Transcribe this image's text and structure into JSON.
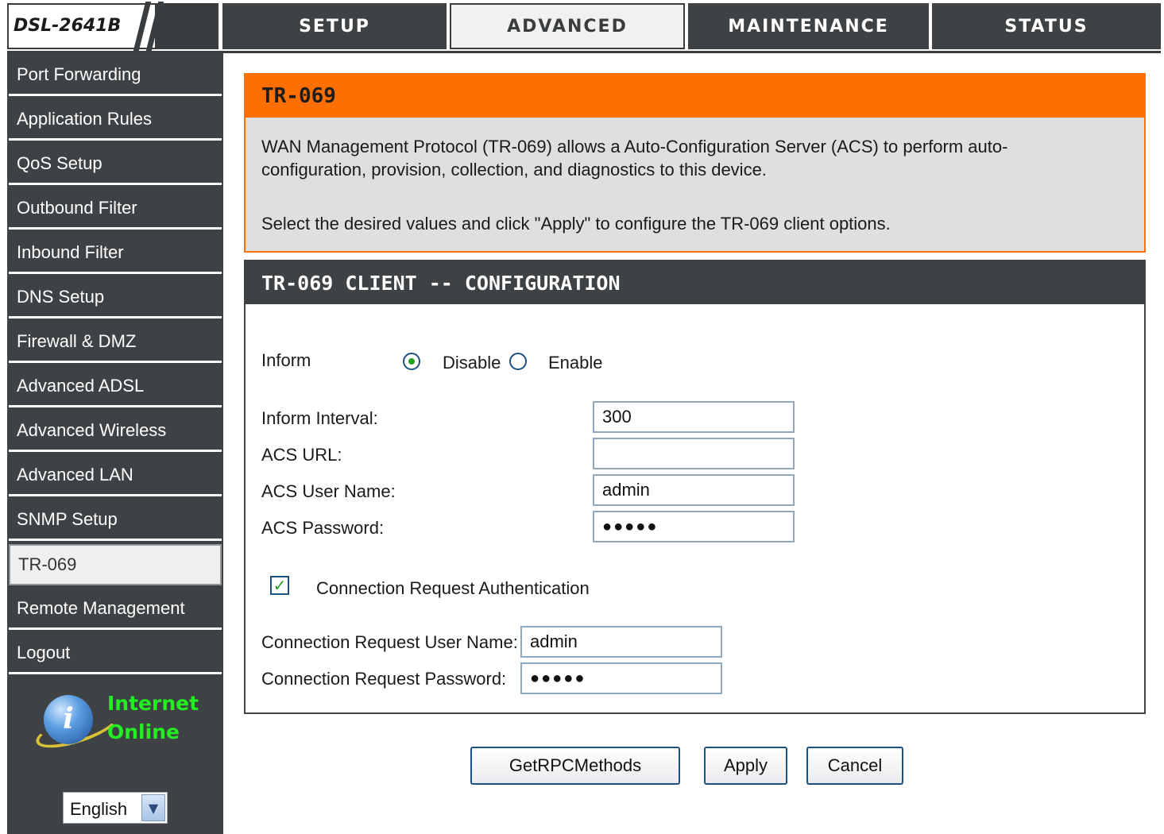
{
  "brand": {
    "model": "DSL-2641B"
  },
  "topnav": {
    "tabs": [
      {
        "label": "SETUP"
      },
      {
        "label": "ADVANCED"
      },
      {
        "label": "MAINTENANCE"
      },
      {
        "label": "STATUS"
      }
    ],
    "active": "ADVANCED"
  },
  "sidebar": {
    "items": [
      {
        "label": "Port Forwarding"
      },
      {
        "label": "Application Rules"
      },
      {
        "label": "QoS Setup"
      },
      {
        "label": "Outbound Filter"
      },
      {
        "label": "Inbound Filter"
      },
      {
        "label": "DNS Setup"
      },
      {
        "label": "Firewall & DMZ"
      },
      {
        "label": "Advanced ADSL"
      },
      {
        "label": "Advanced Wireless"
      },
      {
        "label": "Advanced LAN"
      },
      {
        "label": "SNMP Setup"
      },
      {
        "label": "TR-069"
      },
      {
        "label": "Remote Management"
      },
      {
        "label": "Logout"
      }
    ],
    "active": "TR-069",
    "status": {
      "line1": "Internet",
      "line2": "Online",
      "color": "#22ee22"
    },
    "language": {
      "selected": "English"
    }
  },
  "intro": {
    "title": "TR-069",
    "paragraph1_line1": "WAN Management Protocol (TR-069) allows a Auto-Configuration Server (ACS) to perform auto-",
    "paragraph1_line2": "configuration, provision, collection, and diagnostics to this device.",
    "paragraph2": "Select the desired values and click \"Apply\" to configure the TR-069 client options."
  },
  "config": {
    "title": "TR-069 CLIENT -- CONFIGURATION",
    "inform_label": "Inform",
    "inform_options": {
      "disable": "Disable",
      "enable": "Enable"
    },
    "inform_selected": "Disable",
    "inform_interval_label": "Inform Interval:",
    "inform_interval_value": "300",
    "acs_url_label": "ACS URL:",
    "acs_url_value": "",
    "acs_user_label": "ACS User Name:",
    "acs_user_value": "admin",
    "acs_password_label": "ACS Password:",
    "acs_password_value": "●●●●●",
    "conn_auth_label": "Connection Request Authentication",
    "conn_auth_checked": true,
    "conn_user_label": "Connection Request User Name:",
    "conn_user_value": "admin",
    "conn_password_label": "Connection Request Password:",
    "conn_password_value": "●●●●●"
  },
  "buttons": {
    "getrpc": "GetRPCMethods",
    "apply": "Apply",
    "cancel": "Cancel"
  },
  "colors": {
    "nav_dark": "#3f4244",
    "accent_orange": "#ff6f00",
    "status_green": "#22ee22"
  }
}
